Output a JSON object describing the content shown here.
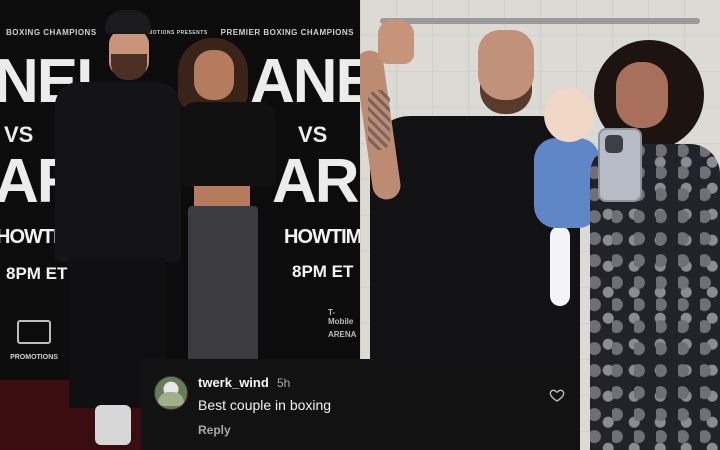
{
  "left_photo": {
    "backdrop_top_left": "BOXING CHAMPIONS",
    "backdrop_top_mid": "CANELO PROMOTIONS PRESENTS",
    "backdrop_top_right": "PREMIER BOXING CHAMPIONS",
    "name_fragment_1": "NEL",
    "name_fragment_2": "ANEL",
    "vs_text": "VS",
    "name_fragment_3": "ARI",
    "name_fragment_4": "ARI",
    "network_1": "HOWTIME",
    "network_2": "HOWTIME",
    "airtime_1": "8PM ET",
    "airtime_2": "8PM ET",
    "promo_logo": "PROMOTIONS",
    "sponsor_1": "T-Mobile",
    "sponsor_2": "ARENA"
  },
  "comment": {
    "username": "twerk_wind",
    "time_ago": "5h",
    "text": "Best couple in boxing",
    "reply_label": "Reply",
    "like_icon": "heart-outline-icon"
  },
  "colors": {
    "comment_bg": "#121212",
    "muted_text": "#a8a8a8"
  }
}
